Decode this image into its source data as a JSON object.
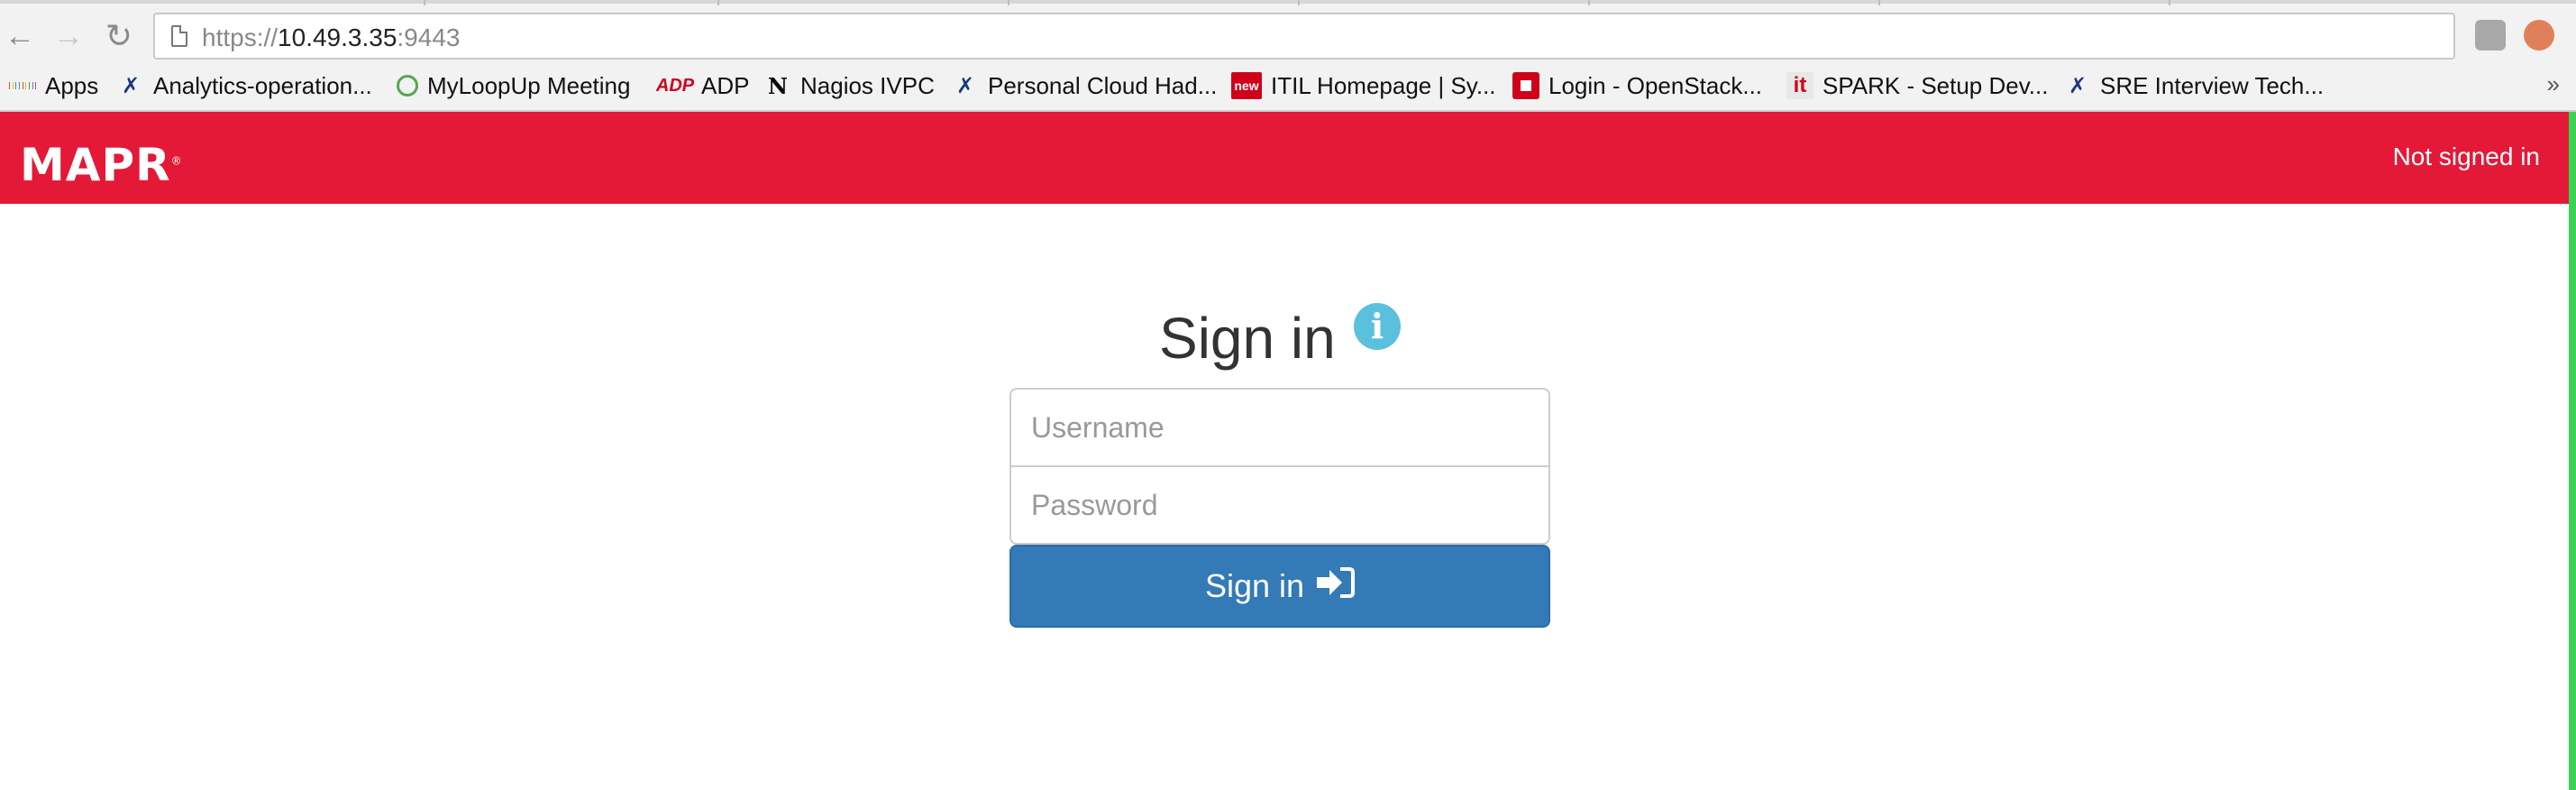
{
  "browser": {
    "url_prefix": "https://",
    "url_host": "10.49.3.35",
    "url_port": ":9443",
    "bookmarks": [
      {
        "label": "Apps",
        "icon": "apps-grid-icon"
      },
      {
        "label": "Analytics-operation...",
        "icon": "x-logo-icon"
      },
      {
        "label": "MyLoopUp Meeting",
        "icon": "loopup-icon"
      },
      {
        "label": "ADP",
        "icon": "adp-icon"
      },
      {
        "label": "Nagios IVPC",
        "icon": "nagios-icon"
      },
      {
        "label": "Personal Cloud Had...",
        "icon": "x-logo-icon"
      },
      {
        "label": "ITIL Homepage | Sy...",
        "icon": "new-badge-icon"
      },
      {
        "label": "Login - OpenStack...",
        "icon": "openstack-icon"
      },
      {
        "label": "SPARK - Setup Dev...",
        "icon": "it-icon"
      },
      {
        "label": "SRE Interview Tech...",
        "icon": "x-logo-icon"
      }
    ],
    "more": "»",
    "adp_glyph": "ADP",
    "n_glyph": "N",
    "new_glyph": "new",
    "it_glyph": "it"
  },
  "header": {
    "logo": "MAPR",
    "logo_mark": "®",
    "status": "Not signed in",
    "brand_color": "#e31937"
  },
  "login": {
    "title": "Sign in",
    "info_glyph": "i",
    "username_placeholder": "Username",
    "password_placeholder": "Password",
    "button_label": "Sign in",
    "button_icon": "sign-in-arrow-icon",
    "button_color": "#337ab7"
  }
}
